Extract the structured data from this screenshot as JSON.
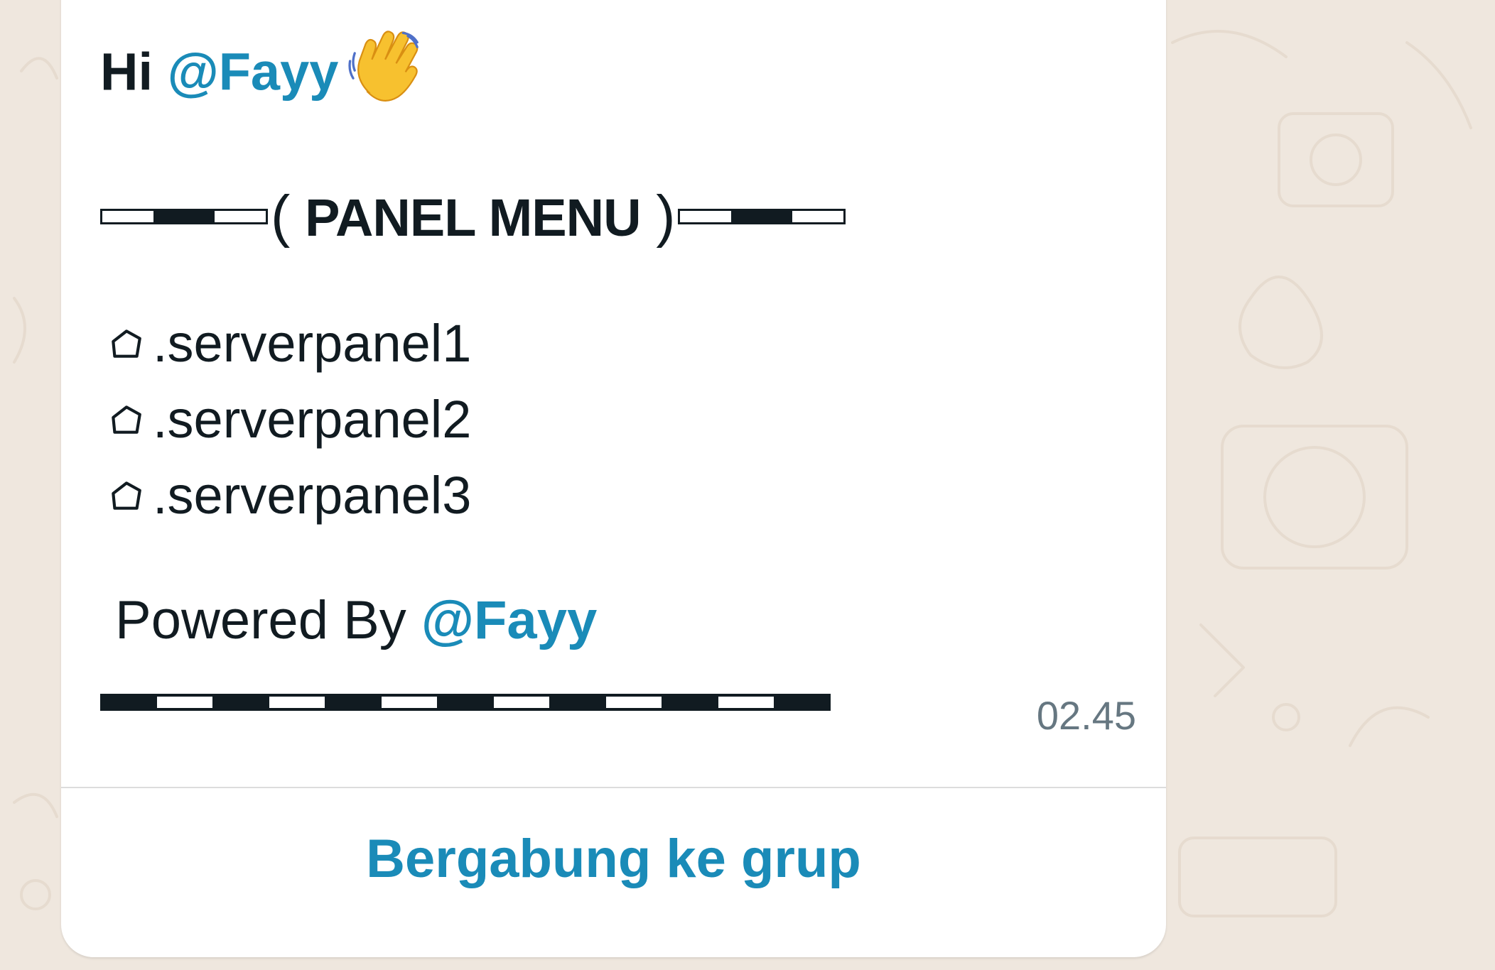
{
  "message": {
    "greeting_prefix": "Hi ",
    "greeting_mention": "@Fayy",
    "greeting_emoji": "waving-hand-icon",
    "panel_title": "PANEL MENU",
    "panel_open": "( ",
    "panel_close": " )",
    "menu_items": [
      {
        "icon": "pentagon-icon",
        "label": ".serverpanel1"
      },
      {
        "icon": "pentagon-icon",
        "label": ".serverpanel2"
      },
      {
        "icon": "pentagon-icon",
        "label": ".serverpanel3"
      }
    ],
    "powered_prefix": "Powered By ",
    "powered_mention": "@Fayy",
    "timestamp": "02.45"
  },
  "action_button": {
    "label": "Bergabung ke grup"
  },
  "colors": {
    "mention": "#1a8bb8",
    "text": "#111b21",
    "timestamp": "#667781",
    "wallpaper": "#efe7de",
    "bubble": "#ffffff"
  }
}
